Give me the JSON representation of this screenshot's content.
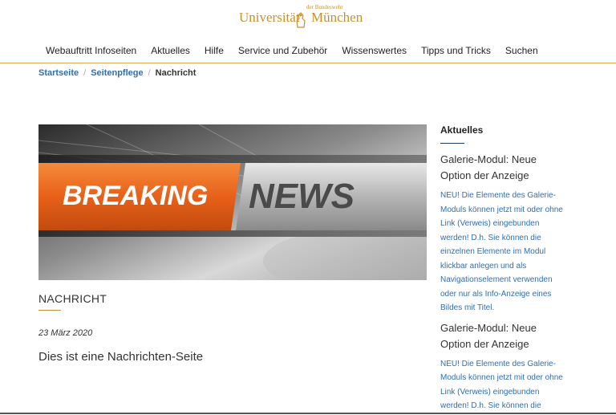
{
  "logo": {
    "small": "der Bundeswehr",
    "left": "Universität",
    "right": "München"
  },
  "nav": [
    "Webauftritt Infoseiten",
    "Aktuelles",
    "Hilfe",
    "Service und Zubehör",
    "Wissenswertes",
    "Tipps und Tricks",
    "Suchen"
  ],
  "breadcrumb": {
    "items": [
      "Startseite",
      "Seitenpflege"
    ],
    "current": "Nachricht"
  },
  "hero": {
    "word1": "BREAKING",
    "word2": "NEWS",
    "colors": {
      "accent": "#e8611a",
      "dark": "#3a3a3a"
    }
  },
  "article": {
    "kicker": "NACHRICHT",
    "date": "23 März 2020",
    "lead": "Dies ist eine Nachrichten-Seite"
  },
  "sidebar": {
    "heading": "Aktuelles",
    "items": [
      {
        "title": "Galerie-Modul: Neue Option der Anzeige",
        "body": "NEU! Die Elemente des Galerie-Moduls können jetzt mit oder ohne Link (Verweis) eingebunden werden! D.h. Sie können die einzelnen Elemente im Modul klickbar anlegen und als Navigationselement verwenden oder nur als Info-Anzeige eines Bildes mit Titel."
      },
      {
        "title": "Galerie-Modul: Neue Option der Anzeige",
        "body": "NEU! Die Elemente des Galerie-Moduls können jetzt mit oder ohne Link (Verweis) eingebunden werden! D.h. Sie können die"
      }
    ]
  }
}
